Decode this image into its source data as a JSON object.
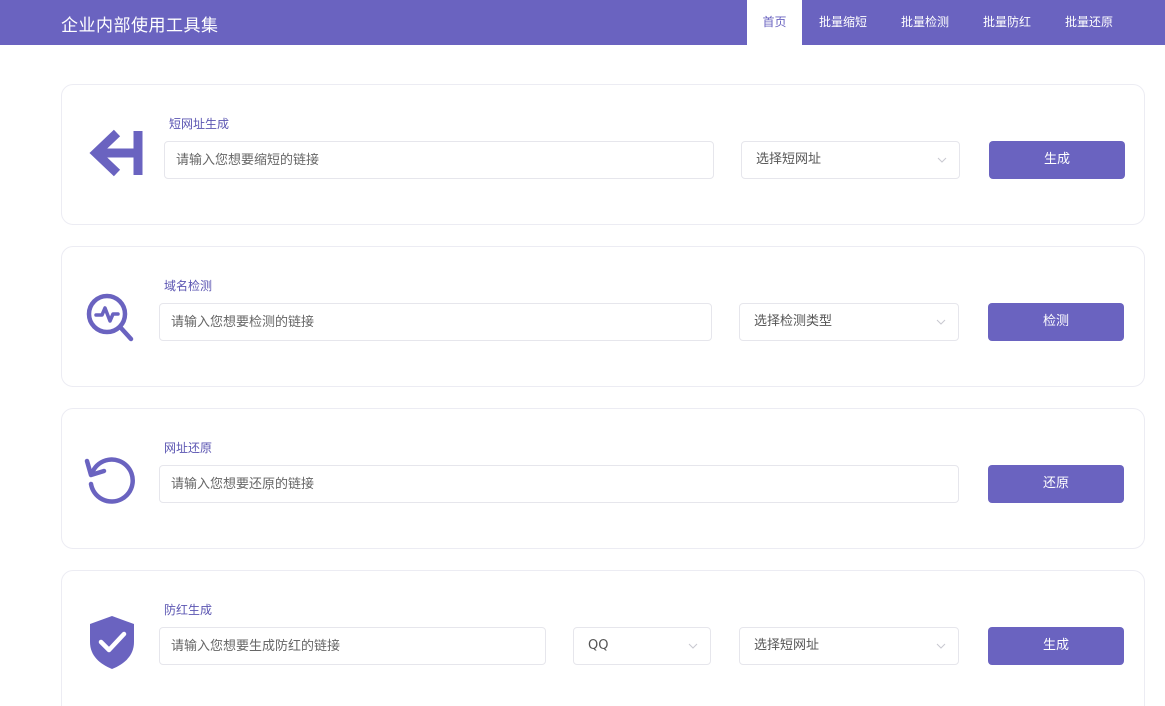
{
  "header": {
    "brand": "企业内部使用工具集",
    "nav": [
      "首页",
      "批量缩短",
      "批量检测",
      "批量防红",
      "批量还原"
    ]
  },
  "colors": {
    "accent": "#6a63c0",
    "background": "#ffffff",
    "card_border": "#ececf3"
  },
  "cards": {
    "shorten": {
      "title": "短网址生成",
      "icon": "arrow-left-bar-icon",
      "input_placeholder": "请输入您想要缩短的链接",
      "select_value": "选择短网址",
      "button": "生成"
    },
    "detect": {
      "title": "域名检测",
      "icon": "pulse-search-icon",
      "input_placeholder": "请输入您想要检测的链接",
      "select_value": "选择检测类型",
      "button": "检测"
    },
    "restore": {
      "title": "网址还原",
      "icon": "undo-circle-icon",
      "input_placeholder": "请输入您想要还原的链接",
      "button": "还原"
    },
    "antiblock": {
      "title": "防红生成",
      "icon": "shield-check-icon",
      "input_placeholder": "请输入您想要生成防红的链接",
      "platform_value": "QQ",
      "select_value": "选择短网址",
      "button": "生成"
    }
  }
}
